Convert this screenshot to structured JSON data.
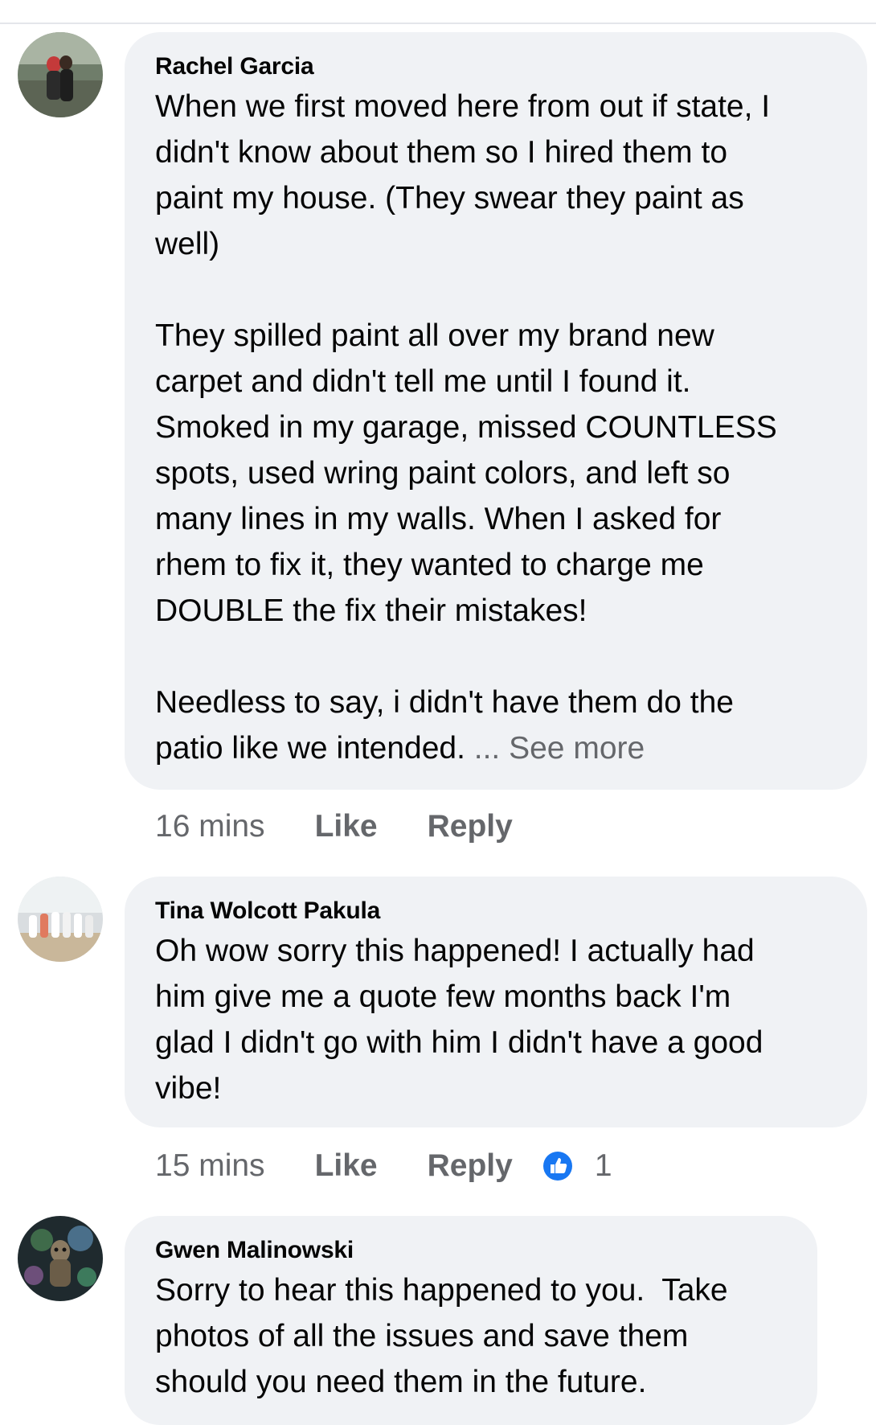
{
  "comments": [
    {
      "author": "Rachel Garcia",
      "text": "When we first moved here from out if state, I\ndidn't know about them so I hired them to\npaint my house. (They swear they paint as\nwell)\n\nThey spilled paint all over my brand new\ncarpet and didn't tell me until I found it.\nSmoked in my garage, missed COUNTLESS\nspots, used wring paint colors, and left so\nmany lines in my walls. When I asked for\nrhem to fix it, they wanted to charge me\nDOUBLE the fix their mistakes!\n\nNeedless to say, i didn't have them do the\npatio like we intended. ",
      "see_more": "... See more",
      "time": "16 mins",
      "like_label": "Like",
      "reply_label": "Reply"
    },
    {
      "author": "Tina Wolcott Pakula",
      "text": "Oh wow sorry this happened! I actually had\nhim give me a quote few months back I'm\nglad I didn't go with him I didn't have a good\nvibe!",
      "time": "15 mins",
      "like_label": "Like",
      "reply_label": "Reply",
      "reaction_icon": "like-reaction-icon",
      "reaction_count": "1"
    },
    {
      "author": "Gwen Malinowski",
      "text": "Sorry to hear this happened to you.  Take\nphotos of all the issues and save them\nshould you need them in the future."
    }
  ],
  "colors": {
    "bubble_bg": "#f0f2f5",
    "text": "#050505",
    "secondary": "#65676b",
    "like_blue": "#1877f2"
  }
}
